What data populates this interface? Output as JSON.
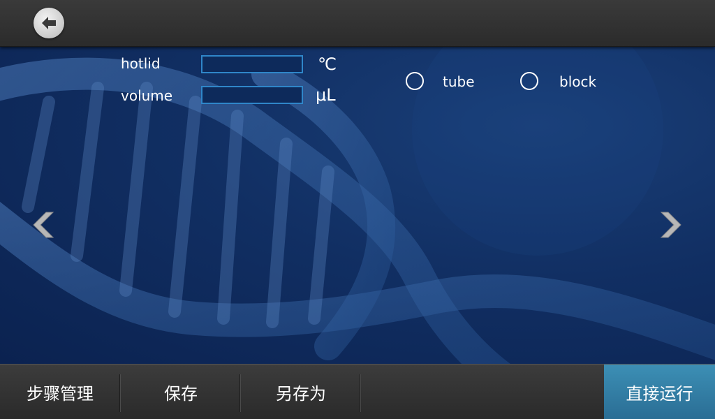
{
  "header": {
    "back_icon": "back-arrow-icon"
  },
  "form": {
    "hotlid_label": "hotlid",
    "hotlid_value": "",
    "hotlid_unit": "℃",
    "volume_label": "volume",
    "volume_value": "",
    "volume_unit": "μL"
  },
  "mode": {
    "options": [
      "tube",
      "block"
    ],
    "selected": null
  },
  "navigation": {
    "prev_icon": "chevron-left-icon",
    "next_icon": "chevron-right-icon"
  },
  "bottom": {
    "tabs": [
      "步骤管理",
      "保存",
      "另存为"
    ],
    "run_label": "直接运行"
  },
  "colors": {
    "accent": "#2f86c9",
    "run_button": "#3c8fb5",
    "background": "#112f63"
  }
}
